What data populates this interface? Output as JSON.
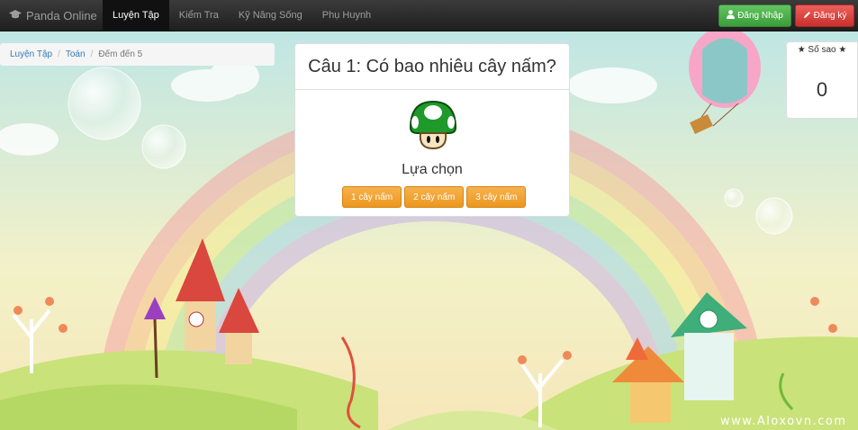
{
  "navbar": {
    "brand": "Panda Online",
    "items": [
      {
        "label": "Luyện Tập",
        "active": true
      },
      {
        "label": "Kiểm Tra",
        "active": false
      },
      {
        "label": "Kỹ Năng Sống",
        "active": false
      },
      {
        "label": "Phụ Huynh",
        "active": false
      }
    ],
    "login_label": "Đăng Nhập",
    "register_label": "Đăng ký"
  },
  "breadcrumb": {
    "items": [
      "Luyện Tập",
      "Toán",
      "Đếm đến 5"
    ]
  },
  "question": {
    "title": "Câu 1: Có bao nhiêu cây nấm?",
    "image_icon": "green-mushroom-icon",
    "choose_label": "Lựa chọn",
    "answers": [
      "1 cây nấm",
      "2 cây nấm",
      "3 cây nấm"
    ]
  },
  "stars": {
    "label": "★ Số sao ★",
    "value": "0"
  },
  "watermark": "www.Aloxovn.com",
  "colors": {
    "navbar": "#222222",
    "login": "#5cb85c",
    "register": "#d9534f",
    "answer": "#f0ad4e",
    "link": "#337ab7"
  }
}
